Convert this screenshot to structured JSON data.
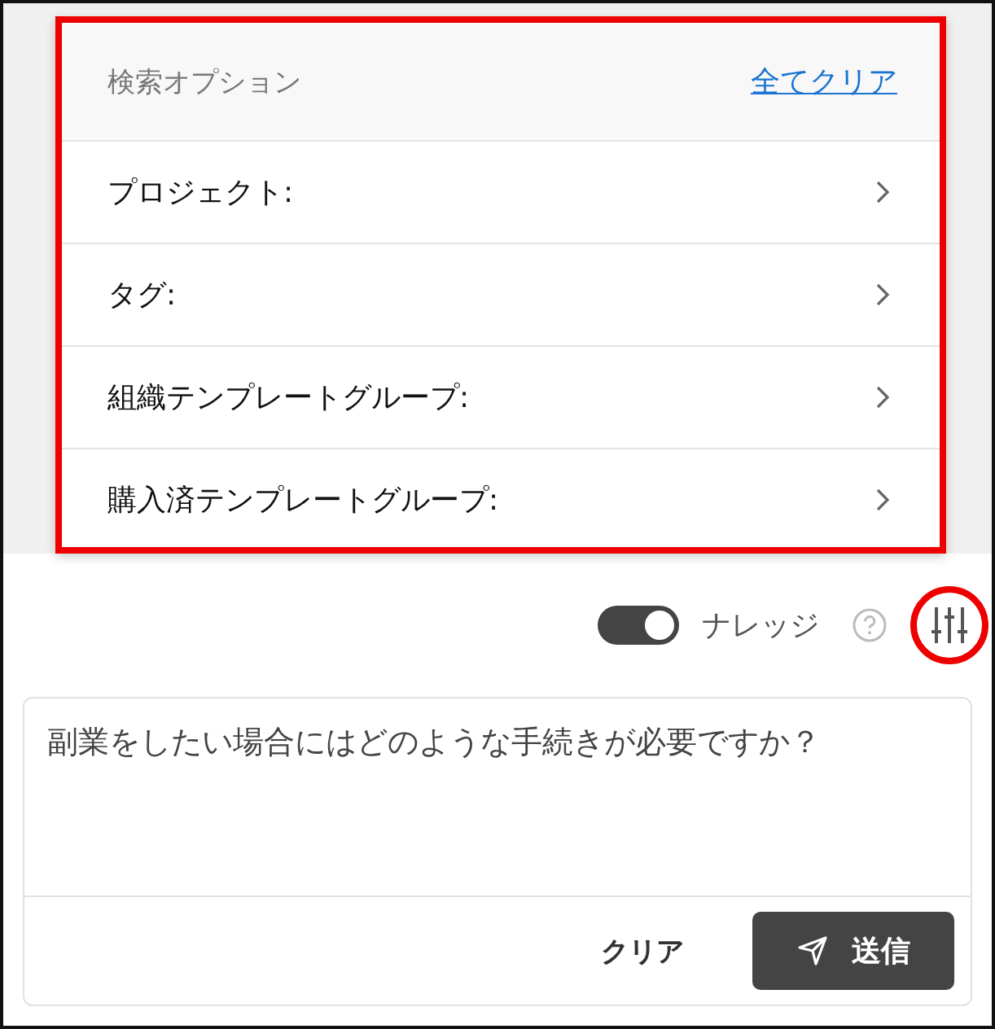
{
  "search_options": {
    "title": "検索オプション",
    "clear_all_link": "全てクリア",
    "highlighted": true,
    "items": [
      {
        "label": "プロジェクト:"
      },
      {
        "label": "タグ:"
      },
      {
        "label": "組織テンプレートグループ:"
      },
      {
        "label": "購入済テンプレートグループ:"
      }
    ]
  },
  "knowledge_toggle": {
    "label": "ナレッジ",
    "on": true
  },
  "filter_button": {
    "highlighted": true
  },
  "question": {
    "value": "副業をしたい場合にはどのような手続きが必要ですか？"
  },
  "buttons": [
    {
      "kind": "plain",
      "label": "クリア"
    },
    {
      "kind": "primary",
      "label": "送信"
    }
  ]
}
